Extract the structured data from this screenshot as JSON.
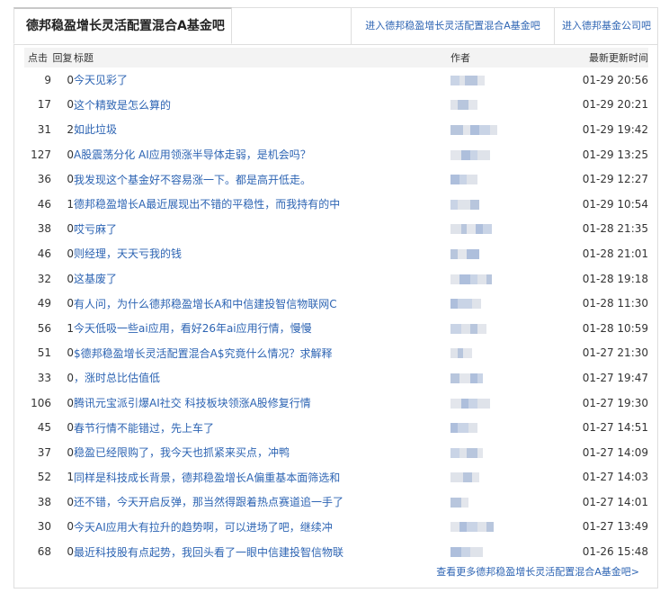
{
  "tabs": {
    "active": "德邦稳盈增长灵活配置混合A基金吧",
    "link1": "进入德邦稳盈增长灵活配置混合A基金吧",
    "link2": "进入德邦基金公司吧"
  },
  "headers": {
    "click": "点击",
    "reply": "回复",
    "title": "标题",
    "author": "作者",
    "time": "最新更新时间"
  },
  "rows": [
    {
      "click": "9",
      "reply": "0",
      "title": "今天见彩了",
      "time": "01-29 20:56"
    },
    {
      "click": "17",
      "reply": "0",
      "title": "这个精致是怎么算的",
      "time": "01-29 20:21"
    },
    {
      "click": "31",
      "reply": "2",
      "title": "如此垃圾",
      "time": "01-29 19:42"
    },
    {
      "click": "127",
      "reply": "0",
      "title": "A股震荡分化 AI应用领涨半导体走弱，是机会吗？",
      "time": "01-29 13:25"
    },
    {
      "click": "36",
      "reply": "0",
      "title": "我发现这个基金好不容易涨一下。都是高开低走。",
      "time": "01-29 12:27"
    },
    {
      "click": "46",
      "reply": "1",
      "title": "德邦稳盈增长A最近展现出不错的平稳性，而我持有的中",
      "time": "01-29 10:54"
    },
    {
      "click": "38",
      "reply": "0",
      "title": "哎亏麻了",
      "time": "01-28 21:35"
    },
    {
      "click": "46",
      "reply": "0",
      "title": "则经理，天天亏我的钱",
      "time": "01-28 21:01"
    },
    {
      "click": "32",
      "reply": "0",
      "title": "这基废了",
      "time": "01-28 19:18"
    },
    {
      "click": "49",
      "reply": "0",
      "title": "有人问，为什么德邦稳盈增长A和中信建投智信物联网C",
      "time": "01-28 11:30"
    },
    {
      "click": "56",
      "reply": "1",
      "title": "今天低吸一些ai应用，看好26年ai应用行情，慢慢",
      "time": "01-28 10:59"
    },
    {
      "click": "51",
      "reply": "0",
      "title": "$德邦稳盈增长灵活配置混合A$究竟什么情况？求解释",
      "time": "01-27 21:30"
    },
    {
      "click": "33",
      "reply": "0",
      "title": "，涨时总比估值低",
      "time": "01-27 19:47"
    },
    {
      "click": "106",
      "reply": "0",
      "title": "腾讯元宝派引爆AI社交 科技板块领涨A股修复行情",
      "time": "01-27 19:30"
    },
    {
      "click": "45",
      "reply": "0",
      "title": "春节行情不能错过，先上车了",
      "time": "01-27 14:51"
    },
    {
      "click": "37",
      "reply": "0",
      "title": "稳盈已经限购了，我今天也抓紧来买点，冲鸭",
      "time": "01-27 14:09"
    },
    {
      "click": "52",
      "reply": "1",
      "title": "同样是科技成长背景，德邦稳盈增长A偏重基本面筛选和",
      "time": "01-27 14:03"
    },
    {
      "click": "38",
      "reply": "0",
      "title": "还不错，今天开启反弹，那当然得跟着热点赛道追一手了",
      "time": "01-27 14:01"
    },
    {
      "click": "30",
      "reply": "0",
      "title": "今天AI应用大有拉升的趋势啊，可以进场了吧，继续冲",
      "time": "01-27 13:49"
    },
    {
      "click": "68",
      "reply": "0",
      "title": "最近科技股有点起势，我回头看了一眼中信建投智信物联",
      "time": "01-26 15:48"
    }
  ],
  "more_link": "查看更多德邦稳盈增长灵活配置混合A基金吧>",
  "colors": {
    "link": "#2d64b3",
    "header_bg": "#f3f3f3",
    "border": "#dedede"
  }
}
